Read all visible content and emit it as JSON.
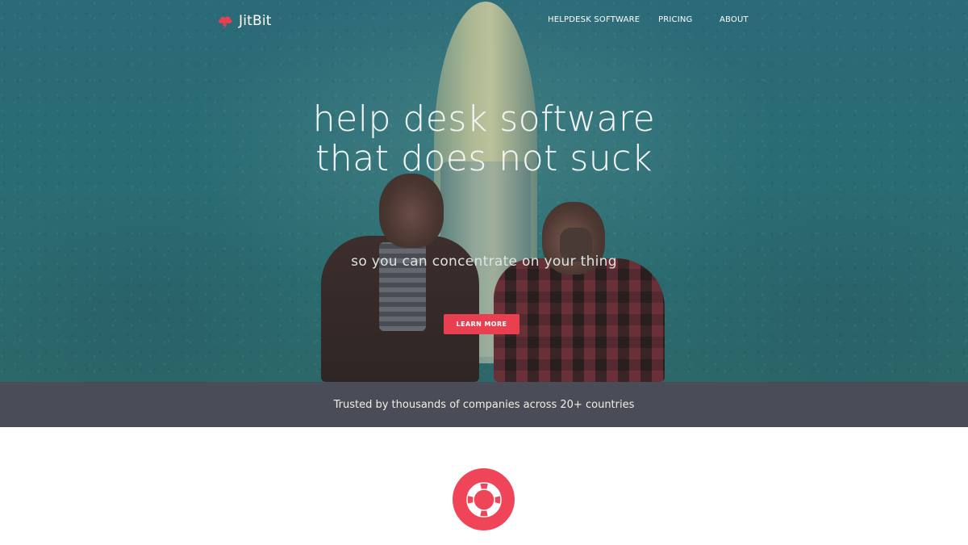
{
  "brand": {
    "name": "JitBit",
    "logo_icon": "cloud-lightning-icon",
    "accent_color": "#e84050"
  },
  "nav": {
    "items": [
      {
        "label": "HELPDESK SOFTWARE"
      },
      {
        "label": "PRICING"
      },
      {
        "label": "ABOUT"
      }
    ]
  },
  "hero": {
    "headline_line1": "help desk software",
    "headline_line2": "that does not suck",
    "subheadline": "so you can concentrate on your thing",
    "cta_label": "LEARN MORE"
  },
  "trust_bar": {
    "text": "Trusted by thousands of companies across 20+ countries"
  },
  "features": {
    "icon": "lifebuoy-icon"
  }
}
